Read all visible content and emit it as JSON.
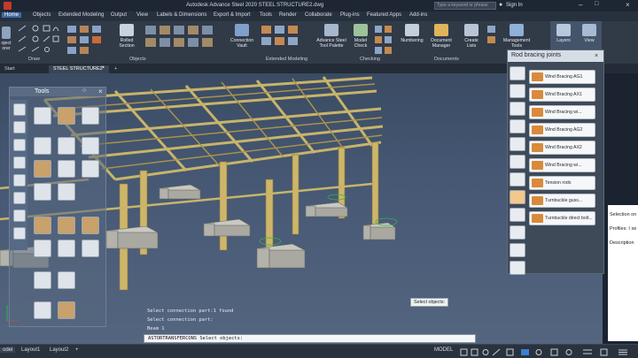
{
  "app": {
    "title": "Autodesk Advance Steel 2020   STEEL STRUCTURE2.dwg",
    "search_placeholder": "Type a keyword or phrase",
    "sign_in": "Sign In"
  },
  "menu": [
    "Home",
    "Objects",
    "Extended Modeling",
    "Output",
    "View",
    "Labels & Dimensions",
    "Export & Import",
    "Tools",
    "Render",
    "Collaborate",
    "Plug-ins",
    "Featured Apps",
    "Add-ins"
  ],
  "ribbon": {
    "buttons": [
      {
        "label": "oject\norer"
      },
      {
        "label": "Rolled\nSection"
      },
      {
        "label": "Connection\nVault"
      },
      {
        "label": "Advance Steel\nTool Palette"
      },
      {
        "label": "Model\nCheck"
      },
      {
        "label": "Numbering"
      },
      {
        "label": "Document\nManager"
      },
      {
        "label": "Create\nLists"
      },
      {
        "label": "Management\nTools"
      },
      {
        "label": "Layers"
      },
      {
        "label": "View"
      }
    ],
    "panels": [
      "Draw",
      "Objects",
      "Extended Modeling",
      "Checking",
      "Documents"
    ]
  },
  "doc_tabs": [
    "Start",
    "STEEL STRUCTURE2*",
    "+"
  ],
  "tools_palette": {
    "title": "Tools"
  },
  "rod_panel": {
    "title": "Rod bracing joints",
    "items": [
      "Wind Bracing AG1",
      "Wind Bracing AX1",
      "Wind Bracing wi...",
      "Wind Bracing AG2",
      "Wind Bracing AX2",
      "Wind Bracing wi...",
      "Tension rods",
      "Turnbuckle guss...",
      "Turnbuckle direct bolt..."
    ]
  },
  "properties": {
    "lines": [
      "Selection on",
      "Profiles: I se",
      "Description"
    ]
  },
  "command": {
    "history": [
      "Select connection part:1 found",
      "Select connection part:",
      "Beam 1"
    ],
    "prompt": "ASTORTRANSFERCONS Select objects:"
  },
  "tooltip": "Select objects:",
  "status": {
    "tabs": [
      "odel",
      "Layout1",
      "Layout2",
      "+"
    ],
    "mode": "MODEL"
  },
  "colors": {
    "steel": "#c8b46a",
    "concrete": "#c4c4bc",
    "accent": "#3b7fd1"
  }
}
